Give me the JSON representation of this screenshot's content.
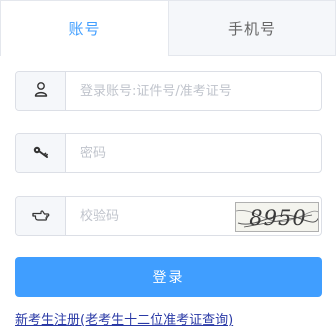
{
  "tabs": [
    {
      "label": "账号",
      "active": true
    },
    {
      "label": "手机号",
      "active": false
    }
  ],
  "form": {
    "account": {
      "icon": "user-icon",
      "placeholder": "登录账号:证件号/准考证号",
      "value": ""
    },
    "password": {
      "icon": "key-icon",
      "placeholder": "密码",
      "value": ""
    },
    "captcha": {
      "icon": "pointing-hand-icon",
      "placeholder": "校验码",
      "value": "",
      "image_text": "8950"
    }
  },
  "login_label": "登录",
  "register_link": "新考生注册(老考生十二位准考证查询)",
  "colors": {
    "accent": "#409eff",
    "link": "#2a3aa6",
    "border": "#dcdfe6",
    "prefix_bg": "#f5f7fa"
  }
}
